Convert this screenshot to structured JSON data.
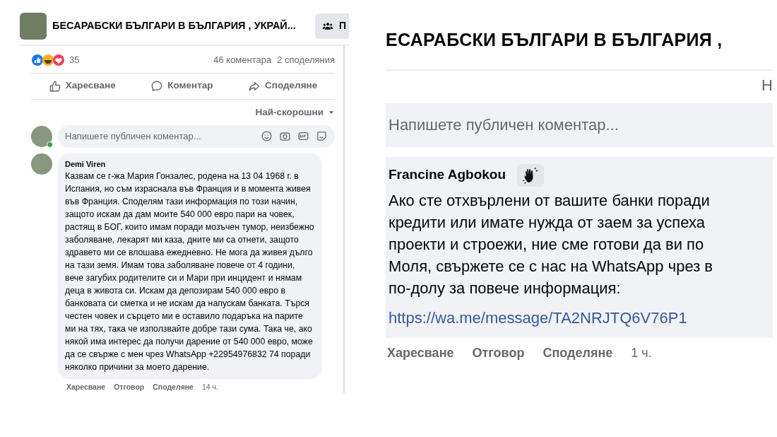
{
  "left_screenshot": {
    "group_title": "БЕСАРАБСКИ БЪЛГАРИ В БЪЛГАРИЯ , УКРАЙ...",
    "group_button": "П",
    "reactions_count": "35",
    "comments_count": "46 коментара",
    "shares_count": "2 споделяния",
    "actions": [
      {
        "kind": "like",
        "label": "Харесване"
      },
      {
        "kind": "comment",
        "label": "Коментар"
      },
      {
        "kind": "share",
        "label": "Споделяне"
      }
    ],
    "sort": "Най-скорошни",
    "comment_input": {
      "placeholder": "Напишете публичен коментар...",
      "online": true
    },
    "comment": {
      "author": "Demi Viren",
      "text": "Казвам се г-жа Мария Гонзалес, родена на 13 04 1968 г. в Испания, но съм израснала във Франция и в момента живея във Франция. Споделям тази информация по този начин, защото искам да дам моите 540 000 евро пари на човек, растящ в БОГ, които имам поради мозъчен тумор, неизбежно заболяване, лекарят ми каза, дните ми са отнети, защото здравето ми се влошава ежедневно. Не мога да живея дълго на тази земя. Имам това заболяване повече от 4 години, вече загубих родителите си и Мари при инцидент и нямам деца в живота си. Искам да депозирам 540 000 евро в банковата си сметка и не искам да напускам банката. Търся честен човек и сърцето ми е оставило подаръка на парите ми на тях, така че използвайте добре тази сума. Така че, ако някой има интерес да получи дарение от 540 000 евро, може да се свърже с мен чрез WhatsApp +22954976832 74 поради няколко причини за моето дарение.",
      "actions": [
        "Харесване",
        "Отговор",
        "Споделяне"
      ],
      "time": "14 ч."
    }
  },
  "right_screenshot": {
    "group_title": "ЕСАРАБСКИ БЪЛГАРИ В БЪЛГАРИЯ ,",
    "sort": "Н",
    "comment_input": {
      "placeholder": "Напишете публичен коментар..."
    },
    "comment": {
      "author": "Francine Agbokou",
      "lines": [
        "Ако сте отхвърлени от вашите банки поради",
        "кредити или имате нужда от заем за успеха",
        "проекти и строежи, ние сме готови да ви по",
        "Моля, свържете се с нас на WhatsApp чрез в",
        "по-долу за повече информация:"
      ],
      "link": "https://wa.me/message/TA2NRJTQ6V76P1",
      "actions": [
        "Харесване",
        "Отговор",
        "Споделяне"
      ],
      "time": "1 ч."
    }
  }
}
